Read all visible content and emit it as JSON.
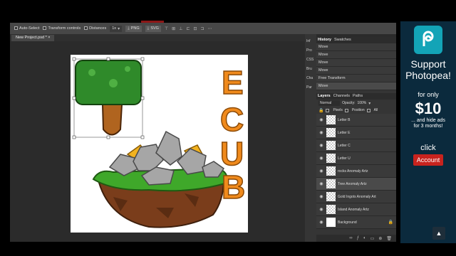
{
  "toolbar": {
    "auto_select": "Auto-Select",
    "transform_controls": "Transform controls",
    "distances": "Distances",
    "zoom": "1x",
    "png": "PNG",
    "svg": "SVG"
  },
  "document": {
    "tab_title": "New Project.psd *",
    "close": "×"
  },
  "side_strip": [
    "Inf",
    "Pro",
    "CSS",
    "Bru",
    "Cha",
    "Par"
  ],
  "panel": {
    "top_tabs": [
      "History",
      "Swatches"
    ],
    "history": [
      "Move",
      "Move",
      "Move",
      "Move",
      "Free Transform",
      "Move"
    ],
    "layers_tabs": [
      "Layers",
      "Channels",
      "Paths"
    ],
    "blend_mode": "Normal",
    "opacity_label": "Opacity:",
    "opacity_value": "100%",
    "lock_label": "",
    "lock_options": [
      "Pixels",
      "Position",
      "All"
    ],
    "layers": [
      "Letter B",
      "Letter E",
      "Letter C",
      "Letter U",
      "rocks Anomaly Artz",
      "Tree Anomaly Artz",
      "Gold Ingots Anomaly Art",
      "Island Anomaly Artz",
      "Background"
    ]
  },
  "artwork": {
    "letters": [
      "E",
      "C",
      "U",
      "B"
    ]
  },
  "ad": {
    "line1": "Support",
    "line2": "Photopea!",
    "for_only": "for only",
    "price": "$10",
    "desc1": "... and hide ads",
    "desc2": "for 3 months!",
    "click": "click",
    "account": "Account"
  },
  "colors": {
    "accent_red": "#c8231e",
    "ad_bg": "#0b2a3d",
    "logo": "#13a4b7",
    "orange": "#f08a1c"
  }
}
